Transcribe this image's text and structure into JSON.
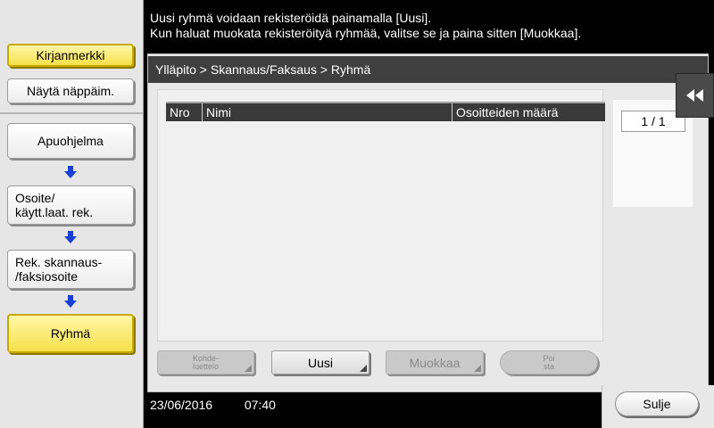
{
  "sidebar": {
    "bookmark_label": "Kirjanmerkki",
    "keypad_label": "Näytä näppäim.",
    "steps": [
      {
        "label": "Apuohjelma"
      },
      {
        "label_line1": "Osoite/",
        "label_line2": "käytt.laat. rek."
      },
      {
        "label_line1": "Rek. skannaus-",
        "label_line2": "/faksiosoite"
      },
      {
        "label": "Ryhmä"
      }
    ]
  },
  "message": {
    "line1": "Uusi ryhmä voidaan rekisteröidä painamalla [Uusi].",
    "line2": "Kun haluat muokata rekisteröityä ryhmää, valitse se ja paina sitten [Muokkaa]."
  },
  "breadcrumb": "Ylläpito > Skannaus/Faksaus > Ryhmä",
  "table": {
    "columns": [
      "Nro",
      "Nimi",
      "Osoitteiden määrä"
    ],
    "rows": []
  },
  "pagination": "1  /  1",
  "buttons": {
    "address_book_line1": "Kohde-",
    "address_book_line2": "luettelo",
    "new": "Uusi",
    "edit": "Muokkaa",
    "delete_line1": "Poi",
    "delete_line2": "sta",
    "close": "Sulje"
  },
  "status": {
    "date": "23/06/2016",
    "time": "07:40"
  },
  "colors": {
    "active_step": "#f6e04a",
    "titlebar": "#3f3f3f",
    "step_arrow": "#1a3fd6"
  },
  "icons": {
    "collapse": "double-left-arrow-icon",
    "step_arrow": "arrow-down-icon"
  }
}
